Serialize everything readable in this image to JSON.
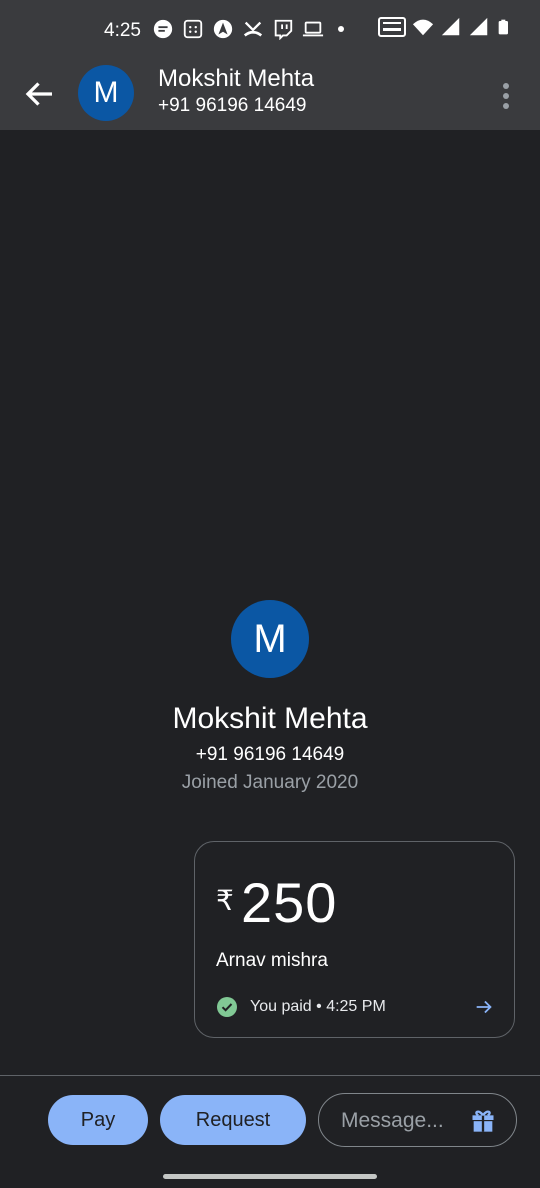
{
  "status_bar": {
    "time": "4:25",
    "icons": [
      "message-icon",
      "calendar-icon",
      "navigation-icon",
      "missed-call-icon",
      "twitch-icon",
      "laptop-icon",
      "dot-icon",
      "vowifi-icon",
      "wifi-icon",
      "signal-icon",
      "signal-icon",
      "battery-icon"
    ]
  },
  "header": {
    "avatar_letter": "M",
    "name": "Mokshit Mehta",
    "phone": "+91 96196 14649"
  },
  "profile": {
    "avatar_letter": "M",
    "name": "Mokshit Mehta",
    "phone": "+91 96196 14649",
    "joined": "Joined January 2020"
  },
  "payment": {
    "currency": "₹",
    "amount": "250",
    "note": "Arnav mishra",
    "status": "You paid • 4:25 PM"
  },
  "actions": {
    "pay_label": "Pay",
    "request_label": "Request",
    "message_placeholder": "Message..."
  },
  "colors": {
    "background": "#202124",
    "bar": "#3a3b3e",
    "avatar": "#0b57a4",
    "accent": "#8ab4f8",
    "success": "#81c995"
  }
}
